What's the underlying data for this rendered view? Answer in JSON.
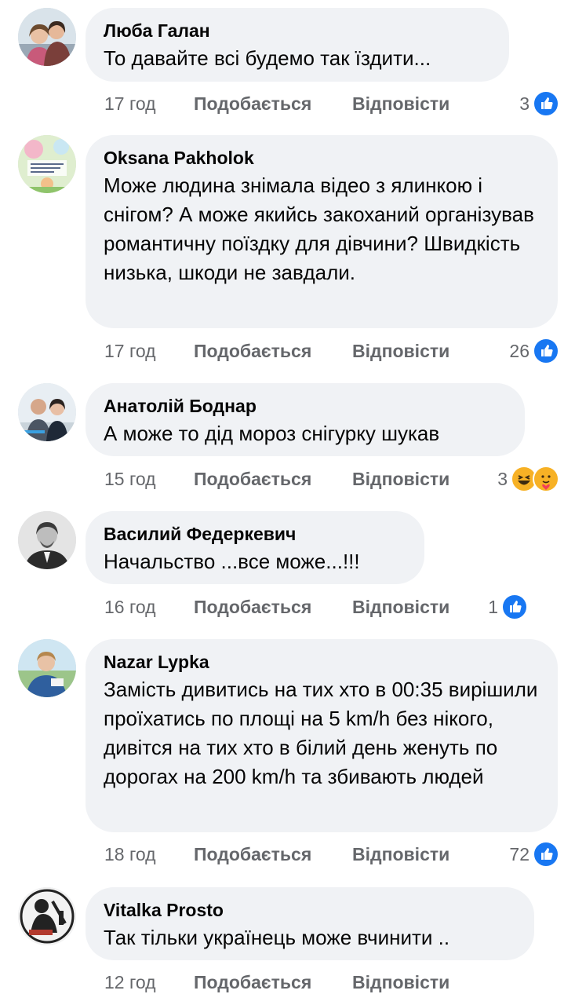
{
  "colors": {
    "bubble_bg": "#f0f2f5",
    "meta_text": "#65676b",
    "like_blue": "#1877f2",
    "haha_yellow": "#f7b125"
  },
  "actions": {
    "like_label": "Подобається",
    "reply_label": "Відповісти"
  },
  "comments": [
    {
      "author": "Люба Галан",
      "text": "То давайте всі будемо так їздити...",
      "time": "17 год",
      "reaction_count": "3",
      "reactions": [
        "like-icon"
      ]
    },
    {
      "author": "Oksana Pakholok",
      "text": "Може людина знімала відео з ялинкою і снігом? А може якийсь закоханий організував романтичну поїздку для дівчини? Швидкість низька, шкоди не завдали.",
      "time": "17 год",
      "reaction_count": "26",
      "reactions": [
        "like-icon"
      ]
    },
    {
      "author": "Анатолій Боднар",
      "text": "А може то дід мороз снігурку шукав",
      "time": "15 год",
      "reaction_count": "3",
      "reactions": [
        "haha-icon",
        "care-icon"
      ]
    },
    {
      "author": "Василий Федеркевич",
      "text": "Начальство ...все може...!!!",
      "time": "16 год",
      "reaction_count": "1",
      "reactions": [
        "like-icon"
      ]
    },
    {
      "author": "Nazar Lypka",
      "text": "Замість дивитись на тих хто в 00:35 вирішили проїхатись по площі на 5 km/h без нікого, дивітся на тих хто в білий день женуть по дорогах на 200 km/h та збивають людей",
      "time": "18 год",
      "reaction_count": "72",
      "reactions": [
        "like-icon"
      ]
    },
    {
      "author": "Vitalka Prosto",
      "text": "Так тільки українець може вчинити ..",
      "time": "12 год",
      "reaction_count": "",
      "reactions": []
    }
  ]
}
